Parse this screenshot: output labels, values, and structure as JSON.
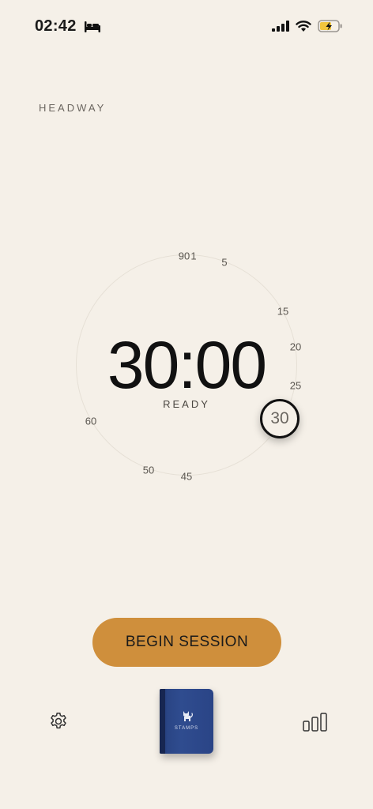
{
  "status_bar": {
    "time": "02:42",
    "icons": [
      "bed-icon",
      "signal-icon",
      "wifi-icon",
      "battery-charging-icon"
    ]
  },
  "brand": "HEADWAY",
  "timer": {
    "display": "30:00",
    "state": "READY",
    "dial_labels": [
      "90",
      "1",
      "5",
      "15",
      "20",
      "25",
      "45",
      "50",
      "60"
    ],
    "selected_minutes": "30"
  },
  "actions": {
    "begin_label": "BEGIN SESSION"
  },
  "bottom_bar": {
    "stamps_label": "STAMPS",
    "left_icon": "settings-gear-icon",
    "right_icon": "stats-bars-icon"
  },
  "colors": {
    "background": "#F5F0E8",
    "accent": "#CF8F3C",
    "book": "#2a4586"
  }
}
